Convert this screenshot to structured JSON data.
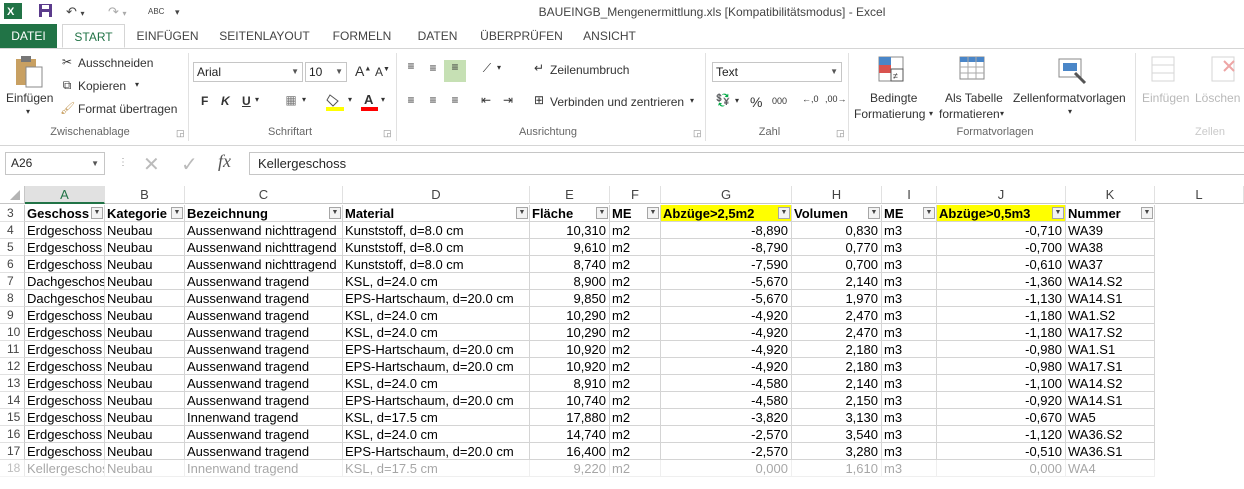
{
  "title": "BAUEINGB_Mengenermittlung.xls  [Kompatibilitätsmodus] - Excel",
  "tabs": [
    "DATEI",
    "START",
    "EINFÜGEN",
    "SEITENLAYOUT",
    "FORMELN",
    "DATEN",
    "ÜBERPRÜFEN",
    "ANSICHT"
  ],
  "ribbon": {
    "clipboard": {
      "paste": "Einfügen",
      "cut": "Ausschneiden",
      "copy": "Kopieren",
      "format_painter": "Format übertragen",
      "group": "Zwischenablage"
    },
    "font": {
      "name": "Arial",
      "size": "10",
      "bold": "F",
      "italic": "K",
      "underline": "U",
      "group": "Schriftart",
      "grow": "A",
      "shrink": "A"
    },
    "alignment": {
      "wrap": "Zeilenumbruch",
      "merge": "Verbinden und zentrieren",
      "group": "Ausrichtung"
    },
    "number": {
      "format": "Text",
      "percent": "%",
      "thousands": "000",
      "group": "Zahl"
    },
    "styles": {
      "conditional": "Bedingte",
      "conditional2": "Formatierung",
      "astable": "Als Tabelle",
      "astable2": "formatieren",
      "cellstyles": "Zellenformatvorlagen",
      "group": "Formatvorlagen"
    },
    "cells": {
      "insert": "Einfügen",
      "delete": "Löschen",
      "group": "Zellen"
    }
  },
  "namebox": "A26",
  "formula": "Kellergeschoss",
  "fx": "fx",
  "columns": [
    "A",
    "B",
    "C",
    "D",
    "E",
    "F",
    "G",
    "H",
    "I",
    "J",
    "K",
    "L"
  ],
  "header_row": {
    "num": "3",
    "cells": [
      "Geschoss",
      "Kategorie",
      "Bezeichnung",
      "Material",
      "Fläche",
      "ME",
      "Abzüge>2,5m2",
      "Volumen",
      "ME",
      "Abzüge>0,5m3",
      "Nummer"
    ]
  },
  "rows": [
    {
      "num": "4",
      "cells": [
        "Erdgeschoss",
        "Neubau",
        "Aussenwand nichttragend",
        "Kunststoff, d=8.0 cm",
        "10,310",
        "m2",
        "-8,890",
        "0,830",
        "m3",
        "-0,710",
        "WA39"
      ]
    },
    {
      "num": "5",
      "cells": [
        "Erdgeschoss",
        "Neubau",
        "Aussenwand nichttragend",
        "Kunststoff, d=8.0 cm",
        "9,610",
        "m2",
        "-8,790",
        "0,770",
        "m3",
        "-0,700",
        "WA38"
      ]
    },
    {
      "num": "6",
      "cells": [
        "Erdgeschoss",
        "Neubau",
        "Aussenwand nichttragend",
        "Kunststoff, d=8.0 cm",
        "8,740",
        "m2",
        "-7,590",
        "0,700",
        "m3",
        "-0,610",
        "WA37"
      ]
    },
    {
      "num": "7",
      "cells": [
        "Dachgeschoss",
        "Neubau",
        "Aussenwand tragend",
        "KSL, d=24.0 cm",
        "8,900",
        "m2",
        "-5,670",
        "2,140",
        "m3",
        "-1,360",
        "WA14.S2"
      ]
    },
    {
      "num": "8",
      "cells": [
        "Dachgeschoss",
        "Neubau",
        "Aussenwand tragend",
        "EPS-Hartschaum, d=20.0 cm",
        "9,850",
        "m2",
        "-5,670",
        "1,970",
        "m3",
        "-1,130",
        "WA14.S1"
      ]
    },
    {
      "num": "9",
      "cells": [
        "Erdgeschoss",
        "Neubau",
        "Aussenwand tragend",
        "KSL, d=24.0 cm",
        "10,290",
        "m2",
        "-4,920",
        "2,470",
        "m3",
        "-1,180",
        "WA1.S2"
      ]
    },
    {
      "num": "10",
      "cells": [
        "Erdgeschoss",
        "Neubau",
        "Aussenwand tragend",
        "KSL, d=24.0 cm",
        "10,290",
        "m2",
        "-4,920",
        "2,470",
        "m3",
        "-1,180",
        "WA17.S2"
      ]
    },
    {
      "num": "11",
      "cells": [
        "Erdgeschoss",
        "Neubau",
        "Aussenwand tragend",
        "EPS-Hartschaum, d=20.0 cm",
        "10,920",
        "m2",
        "-4,920",
        "2,180",
        "m3",
        "-0,980",
        "WA1.S1"
      ]
    },
    {
      "num": "12",
      "cells": [
        "Erdgeschoss",
        "Neubau",
        "Aussenwand tragend",
        "EPS-Hartschaum, d=20.0 cm",
        "10,920",
        "m2",
        "-4,920",
        "2,180",
        "m3",
        "-0,980",
        "WA17.S1"
      ]
    },
    {
      "num": "13",
      "cells": [
        "Erdgeschoss",
        "Neubau",
        "Aussenwand tragend",
        "KSL, d=24.0 cm",
        "8,910",
        "m2",
        "-4,580",
        "2,140",
        "m3",
        "-1,100",
        "WA14.S2"
      ]
    },
    {
      "num": "14",
      "cells": [
        "Erdgeschoss",
        "Neubau",
        "Aussenwand tragend",
        "EPS-Hartschaum, d=20.0 cm",
        "10,740",
        "m2",
        "-4,580",
        "2,150",
        "m3",
        "-0,920",
        "WA14.S1"
      ]
    },
    {
      "num": "15",
      "cells": [
        "Erdgeschoss",
        "Neubau",
        "Innenwand tragend",
        "KSL, d=17.5 cm",
        "17,880",
        "m2",
        "-3,820",
        "3,130",
        "m3",
        "-0,670",
        "WA5"
      ]
    },
    {
      "num": "16",
      "cells": [
        "Erdgeschoss",
        "Neubau",
        "Aussenwand tragend",
        "KSL, d=24.0 cm",
        "14,740",
        "m2",
        "-2,570",
        "3,540",
        "m3",
        "-1,120",
        "WA36.S2"
      ]
    },
    {
      "num": "17",
      "cells": [
        "Erdgeschoss",
        "Neubau",
        "Aussenwand tragend",
        "EPS-Hartschaum, d=20.0 cm",
        "16,400",
        "m2",
        "-2,570",
        "3,280",
        "m3",
        "-0,510",
        "WA36.S1"
      ]
    },
    {
      "num": "18",
      "cells": [
        "Kellergeschoss",
        "Neubau",
        "Innenwand tragend",
        "KSL, d=17.5 cm",
        "9,220",
        "m2",
        "0,000",
        "1,610",
        "m3",
        "0,000",
        "WA4"
      ]
    }
  ],
  "colors": {
    "excel_green": "#217346",
    "highlight": "#ffff00"
  }
}
